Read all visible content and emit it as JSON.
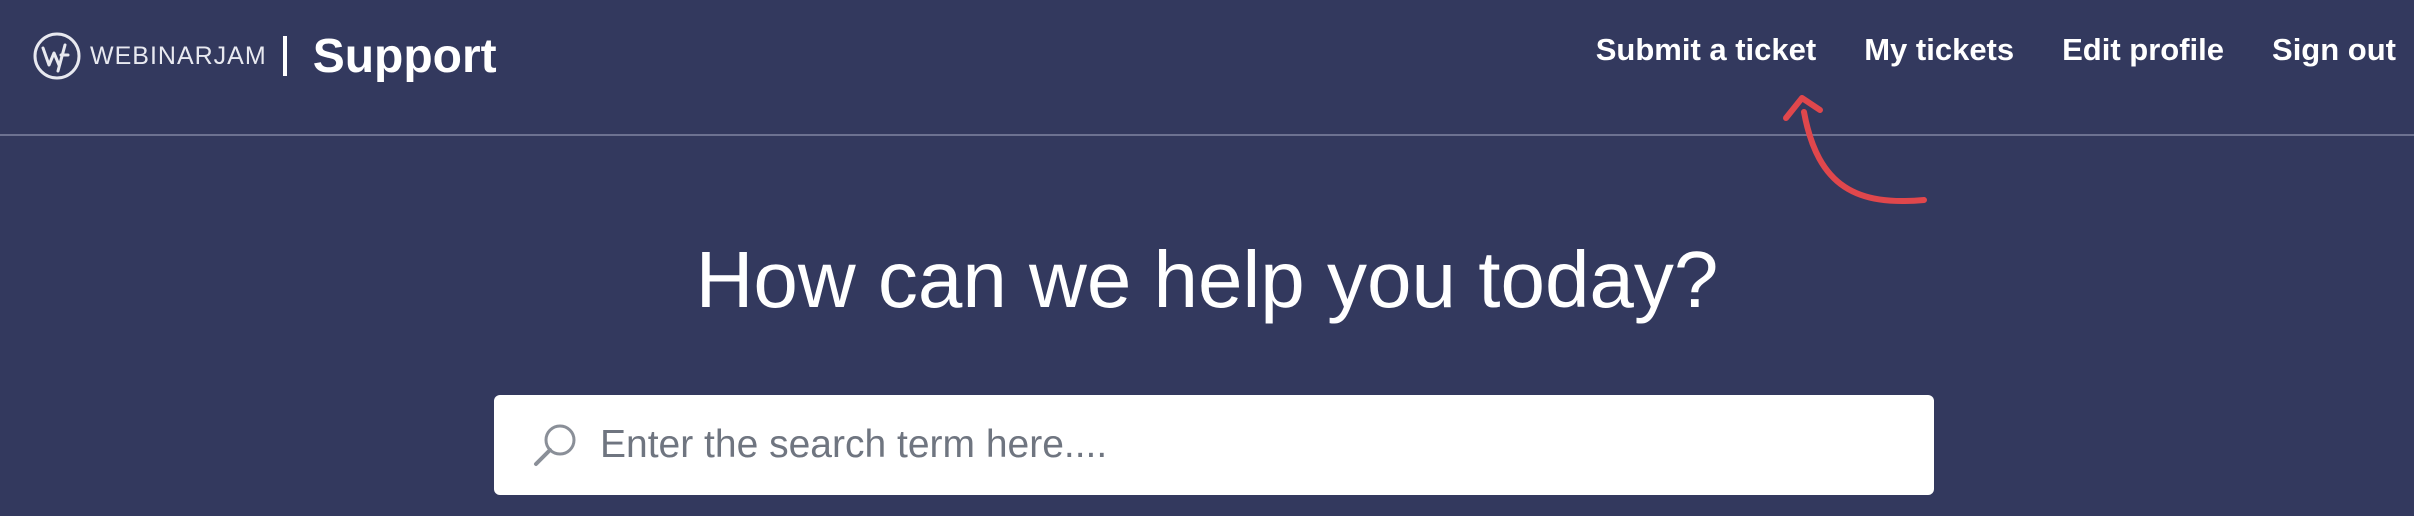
{
  "header": {
    "logo_text": "WEBINARJAM",
    "title": "Support"
  },
  "nav": {
    "items": [
      {
        "label": "Submit a ticket"
      },
      {
        "label": "My tickets"
      },
      {
        "label": "Edit profile"
      },
      {
        "label": "Sign out"
      }
    ]
  },
  "annotation": {
    "icon": "curved-arrow-icon",
    "color": "#e0474c"
  },
  "hero": {
    "title": "How can we help you today?"
  },
  "search": {
    "placeholder": "Enter the search term here....",
    "value": "",
    "icon": "search-icon"
  },
  "colors": {
    "background": "#33395e",
    "text": "#ffffff",
    "divider": "#6d7291"
  }
}
